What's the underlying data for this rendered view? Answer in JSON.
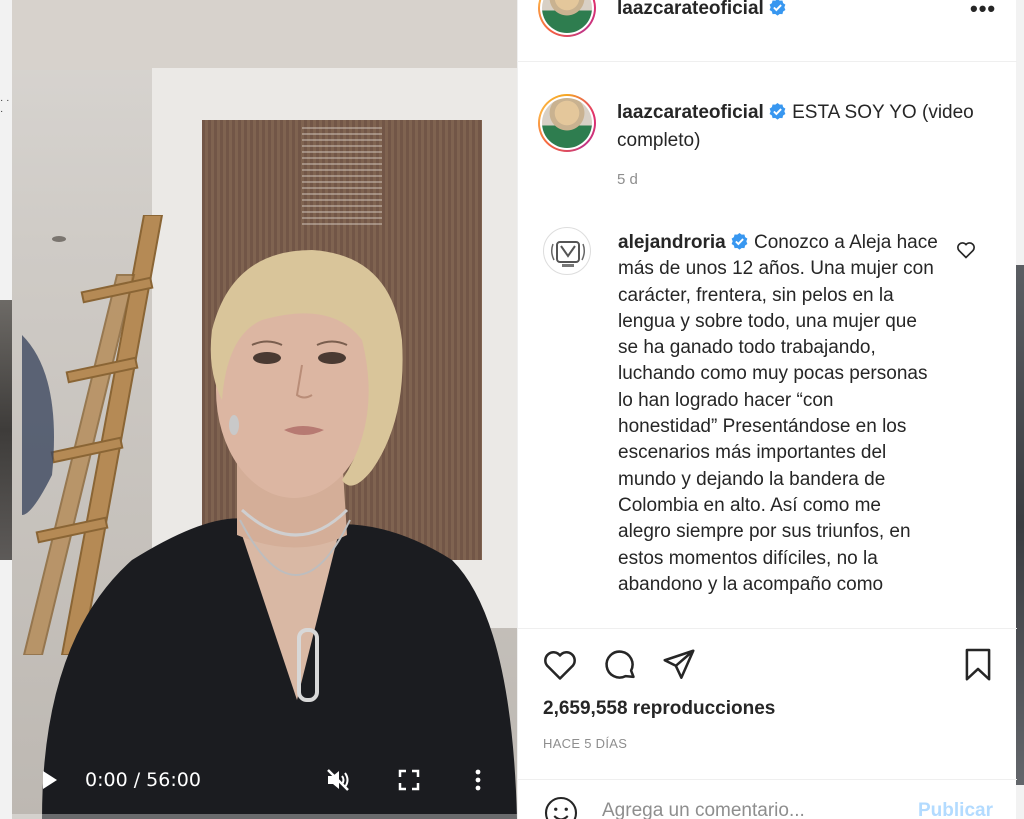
{
  "post": {
    "username": "laazcarateoficial",
    "caption": "ESTA SOY YO (video completo)",
    "caption_time": "5 d"
  },
  "comment": {
    "username": "alejandroria",
    "text": "Conozco a Aleja hace más de unos 12 años. Una mujer con carácter, frentera, sin pelos en la lengua y sobre todo, una mujer que se ha ganado todo trabajando, luchando como muy pocas personas lo han logrado hacer “con honestidad” Presentándose en los escenarios más importantes del mundo y dejando la bandera de Colombia en alto. Así como me alegro siempre por sus triunfos, en estos momentos difíciles, no la abandono y la acompaño como"
  },
  "video": {
    "time": "0:00 / 56:00",
    "progress": 0
  },
  "stats": {
    "views": "2,659,558 reproducciones",
    "ago": "HACE 5 DÍAS"
  },
  "add_comment": {
    "placeholder": "Agrega un comentario...",
    "post_label": "Publicar"
  },
  "header": {
    "more": "•••"
  },
  "icons": {
    "verified": "verified-badge-icon",
    "heart": "heart-icon",
    "comment": "comment-bubble-icon",
    "share": "paper-plane-icon",
    "save": "bookmark-icon",
    "emoji": "smiley-icon",
    "play": "play-icon",
    "mute": "muted-speaker-icon",
    "fullscreen": "fullscreen-icon",
    "more": "vertical-dots-icon"
  },
  "colors": {
    "verified": "#3897f0",
    "post_button": "#b3dbff",
    "muted_text": "#8e8e8e"
  }
}
